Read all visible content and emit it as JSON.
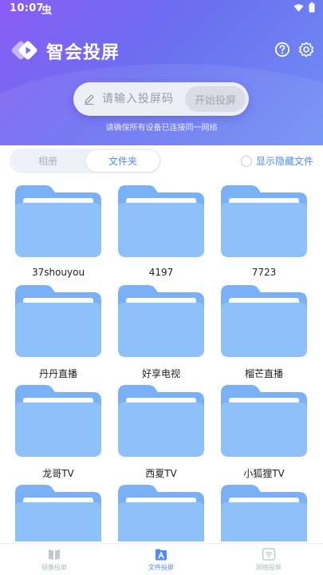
{
  "status_bar": {
    "time": "10:07",
    "notification_glyph": "虫"
  },
  "header": {
    "app_title": "智会投屏"
  },
  "cast_code": {
    "placeholder": "请输入投屏码",
    "start_label": "开始投屏",
    "tip": "请确保所有设备已连接同一网络"
  },
  "tabs": {
    "album": "相册",
    "folder": "文件夹",
    "active": "folder"
  },
  "hidden_files": {
    "label": "显示隐藏文件",
    "checked": false
  },
  "folders": [
    {
      "name": "37shouyou"
    },
    {
      "name": "4197"
    },
    {
      "name": "7723"
    },
    {
      "name": "丹丹直播"
    },
    {
      "name": "好享电视"
    },
    {
      "name": "榴芒直播"
    },
    {
      "name": "龙哥TV"
    },
    {
      "name": "西夏TV"
    },
    {
      "name": "小狐狸TV"
    },
    {
      "name": ""
    },
    {
      "name": ""
    },
    {
      "name": ""
    }
  ],
  "bottom_nav": [
    {
      "label": "镜像投屏",
      "icon": "book-icon",
      "active": false
    },
    {
      "label": "文件投屏",
      "icon": "folder-a-icon",
      "active": true
    },
    {
      "label": "网络投屏",
      "icon": "wifi-cast-icon",
      "active": false
    }
  ],
  "colors": {
    "accent": "#4f8df3",
    "folder_body": "#7ab0f5",
    "folder_front": "#8ec0fa",
    "hero_start": "#8a5cf5",
    "hero_end": "#6f8ff3"
  }
}
